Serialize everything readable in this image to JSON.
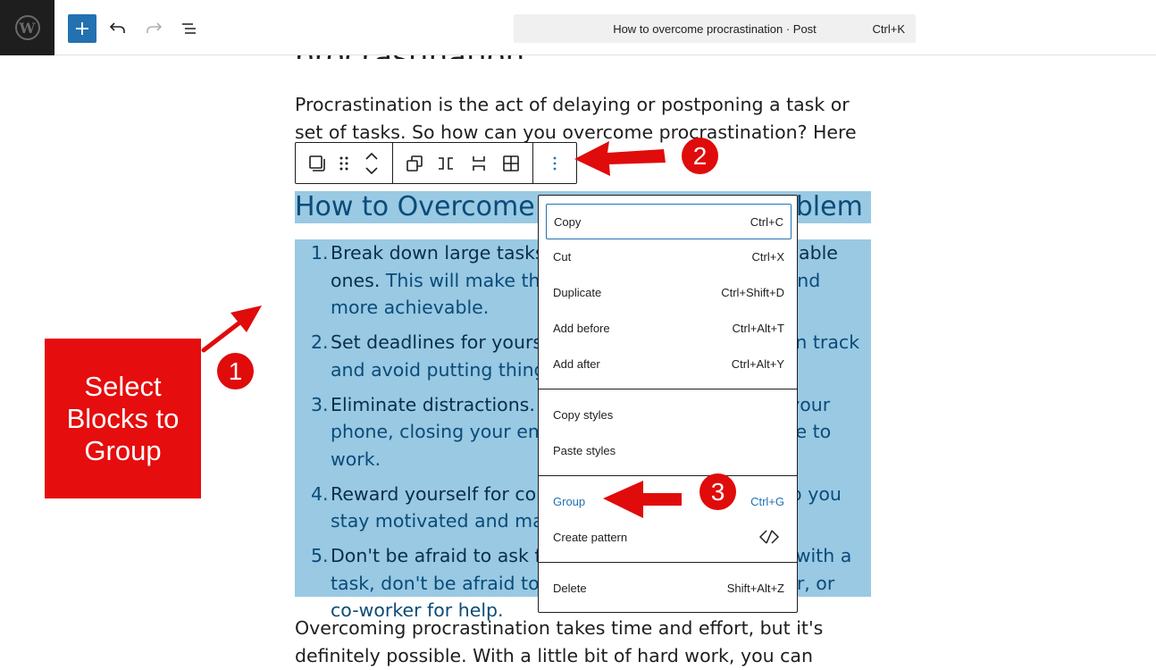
{
  "topbar": {
    "logo_glyph": "W",
    "command_title": "How to overcome procrastination · Post",
    "command_shortcut": "Ctrl+K",
    "accent_color": "#2271b1"
  },
  "content": {
    "paragraph1": "Procrastination is the act of delaying or postponing a task or set of tasks. So how can you overcome procrastination? Here are a",
    "heading": "How to Overcome Procrastination Problem",
    "list_items": [
      {
        "num": "1.",
        "bold": "Break down large tasks into smaller, more manageable ones.",
        "rest": " This will make the task seem less daunting and more achievable."
      },
      {
        "num": "2.",
        "bold": "Set deadlines for yourself.",
        "rest": " This will help you stay on track and avoid putting things off until the last minute."
      },
      {
        "num": "3.",
        "bold": "Eliminate distractions.",
        "rest": " This may mean turning off your phone, closing your email, and finding a quiet place to work."
      },
      {
        "num": "4.",
        "bold": "Reward yourself for completing tasks.",
        "rest": " This will help you stay motivated and make progress."
      },
      {
        "num": "5.",
        "bold": "Don't be afraid to ask for help.",
        "rest": " If you're struggling with a task, don't be afraid to ask a friend, family member, or co-worker for help."
      }
    ],
    "paragraph2": "Overcoming procrastination takes time and effort, but it's definitely possible. With a little bit of hard work, you can break the"
  },
  "block_toolbar": {
    "icons": [
      "list-block-icon",
      "drag-handle-icon",
      "move-up-down-icon",
      "duplicate-blocks-icon",
      "row-icon",
      "stack-icon",
      "grid-icon",
      "options-icon"
    ]
  },
  "menu": {
    "items": [
      {
        "label": "Copy",
        "shortcut": "Ctrl+C"
      },
      {
        "label": "Cut",
        "shortcut": "Ctrl+X"
      },
      {
        "label": "Duplicate",
        "shortcut": "Ctrl+Shift+D"
      },
      {
        "label": "Add before",
        "shortcut": "Ctrl+Alt+T"
      },
      {
        "label": "Add after",
        "shortcut": "Ctrl+Alt+Y"
      },
      {
        "label": "Copy styles",
        "shortcut": ""
      },
      {
        "label": "Paste styles",
        "shortcut": ""
      },
      {
        "label": "Group",
        "shortcut": "Ctrl+G"
      },
      {
        "label": "Create pattern",
        "shortcut": ""
      },
      {
        "label": "Delete",
        "shortcut": "Shift+Alt+Z"
      }
    ]
  },
  "annotations": {
    "callout_text": "Select Blocks to Group",
    "badge1": "1",
    "badge2": "2",
    "badge3": "3",
    "color": "#e00b0b"
  }
}
